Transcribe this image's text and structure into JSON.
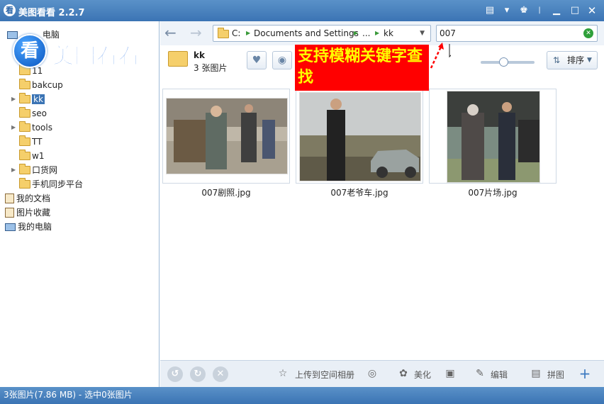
{
  "window": {
    "app_icon": "看",
    "title": "美图看看 2.2.7"
  },
  "sidebar": {
    "partial_root": "电脑",
    "items": [
      {
        "label": "11"
      },
      {
        "label": "bakcup"
      },
      {
        "label": "kk"
      },
      {
        "label": "seo"
      },
      {
        "label": "tools"
      },
      {
        "label": "TT"
      },
      {
        "label": "w1"
      },
      {
        "label": "口货网"
      },
      {
        "label": "手机同步平台"
      }
    ],
    "my_documents": "我的文档",
    "favorites": "图片收藏",
    "my_computer": "我的电脑"
  },
  "logo": {
    "badge": "看",
    "text": "美图看看"
  },
  "nav": {
    "path": [
      "C:",
      "Documents and Settings",
      "...",
      "kk"
    ],
    "search_value": "007"
  },
  "folder": {
    "name": "kk",
    "count": "3 张图片"
  },
  "annotation": "支持模糊关键字查找",
  "sort": {
    "label": "排序"
  },
  "photos": [
    {
      "caption": "007剧照.jpg"
    },
    {
      "caption": "007老爷车.jpg"
    },
    {
      "caption": "007片场.jpg"
    }
  ],
  "bottom": {
    "upload": "上传到空间相册",
    "beautify": "美化",
    "edit": "编辑",
    "puzzle": "拼图"
  },
  "status": "3张图片(7.86 MB) - 选中0张图片",
  "colors": {
    "titlebar": "#3b74b4",
    "annotation_bg": "#ff0000",
    "annotation_text": "#ffff00",
    "logo_blue": "#1a6ae6"
  }
}
